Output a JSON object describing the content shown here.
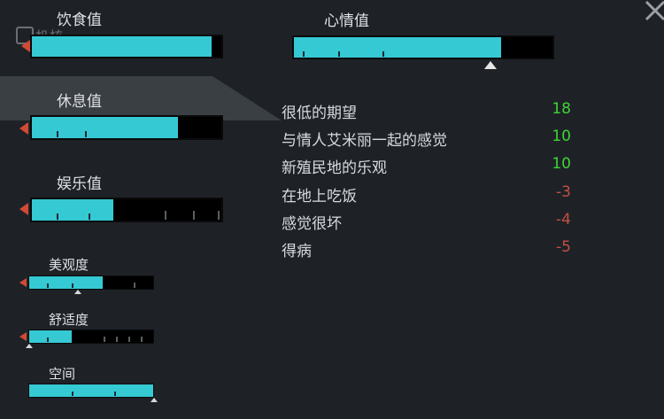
{
  "needs": {
    "food": {
      "label": "饮食值",
      "level": 0.95
    },
    "rest": {
      "label": "休息值",
      "level": 0.77
    },
    "fun": {
      "label": "娱乐值",
      "level": 0.43
    },
    "beauty": {
      "label": "美观度",
      "level": 0.59
    },
    "comfort": {
      "label": "舒适度",
      "level": 0.34
    },
    "space": {
      "label": "空间",
      "level": 1.0
    }
  },
  "mood": {
    "label": "心情值",
    "level": 0.8,
    "thoughts": [
      {
        "text": "很低的期望",
        "value": "18",
        "sign": "positive"
      },
      {
        "text": "与情人艾米丽一起的感觉",
        "value": "10",
        "sign": "positive"
      },
      {
        "text": "新殖民地的乐观",
        "value": "10",
        "sign": "positive"
      },
      {
        "text": "在地上吃饭",
        "value": "-3",
        "sign": "negative"
      },
      {
        "text": "感觉很坏",
        "value": "-4",
        "sign": "negative"
      },
      {
        "text": "得病",
        "value": "-5",
        "sign": "negative"
      }
    ]
  },
  "watermark": "机核",
  "colors": {
    "bar_fill": "#35c9d4",
    "positive": "#3fd435",
    "negative": "#c24f43",
    "arrow": "#d24a35"
  }
}
